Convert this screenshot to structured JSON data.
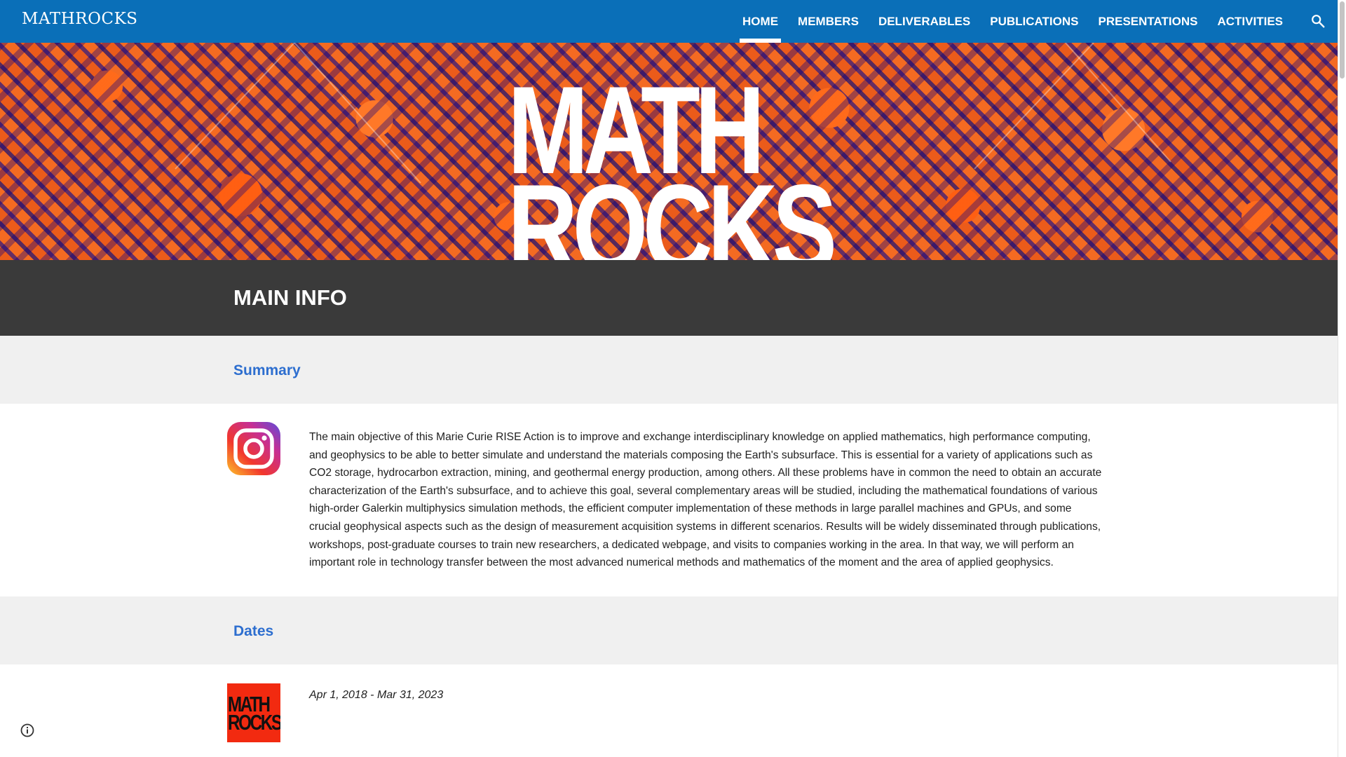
{
  "site": {
    "title": "MATHROCKS"
  },
  "nav": {
    "items": [
      {
        "label": "HOME",
        "active": true
      },
      {
        "label": "MEMBERS",
        "active": false
      },
      {
        "label": "DELIVERABLES",
        "active": false
      },
      {
        "label": "PUBLICATIONS",
        "active": false
      },
      {
        "label": "PRESENTATIONS",
        "active": false
      },
      {
        "label": "ACTIVITIES",
        "active": false
      }
    ],
    "search_icon": "search-icon"
  },
  "banner": {
    "line1": "MATH",
    "line2": "ROCKS"
  },
  "main_info": {
    "heading": "MAIN INFO"
  },
  "summary": {
    "heading": "Summary",
    "text": "The main objective of this Marie Curie RISE Action is to improve and exchange interdisciplinary knowledge on applied mathematics, high performance computing, and geophysics to be able to better simulate and understand the materials composing the Earth's subsurface. This is essential for a variety of applications such as CO2 storage, hydrocarbon extraction, mining, and geothermal energy production, among others. All these problems have in common the need to obtain an accurate characterization of the Earth's subsurface, and to achieve this goal, several complementary areas will be studied, including the mathematical foundations of various high-order Galerkin multiphysics simulation methods, the efficient computer implementation of these methods in large parallel machines and GPUs, and some crucial geophysical aspects such as the design of measurement acquisition systems in different scenarios. Results will be widely disseminated through publications, workshops, post-graduate courses to train new researchers, a dedicated webpage, and visits to companies working in the area. In that way, we will perform an important role in technology transfer between the most advanced numerical methods and mathematics of the moment and the area of applied geophysics.",
    "icon": "instagram-icon"
  },
  "dates": {
    "heading": "Dates",
    "text": "Apr 1, 2018 - Mar 31, 2023",
    "logo_line1": "MATH",
    "logo_line2": "ROCKS"
  },
  "colors": {
    "nav_bg": "#0a6fb8",
    "section_heading": "#2d6ecf",
    "dark_band": "#3a3a3a",
    "light_band": "#f0f0f0"
  }
}
